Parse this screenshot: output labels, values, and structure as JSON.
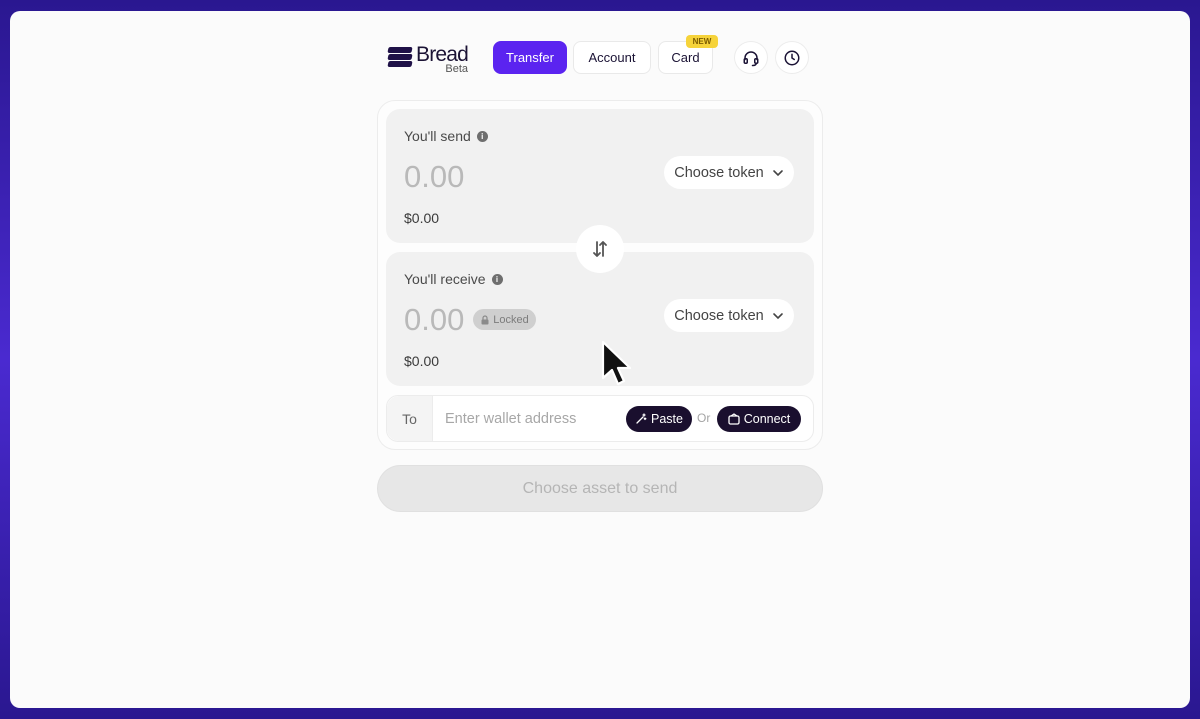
{
  "brand": {
    "name": "Bread",
    "tag": "Beta"
  },
  "nav": {
    "tabs": [
      {
        "label": "Transfer",
        "active": true
      },
      {
        "label": "Account"
      },
      {
        "label": "Card",
        "badge": "NEW"
      }
    ],
    "icons": [
      "headset-icon",
      "clock-icon"
    ]
  },
  "send": {
    "label": "You'll send",
    "amount": "0.00",
    "usd": "$0.00",
    "token_button": "Choose token"
  },
  "receive": {
    "label": "You'll receive",
    "amount": "0.00",
    "locked": "Locked",
    "usd": "$0.00",
    "token_button": "Choose token"
  },
  "recipient": {
    "label": "To",
    "placeholder": "Enter wallet address",
    "paste_label": "Paste",
    "or_label": "Or",
    "connect_label": "Connect"
  },
  "submit_label": "Choose asset to send",
  "colors": {
    "accent": "#5b24f0",
    "badge": "#f6d33a",
    "dark_pill": "#1a0f2e"
  }
}
